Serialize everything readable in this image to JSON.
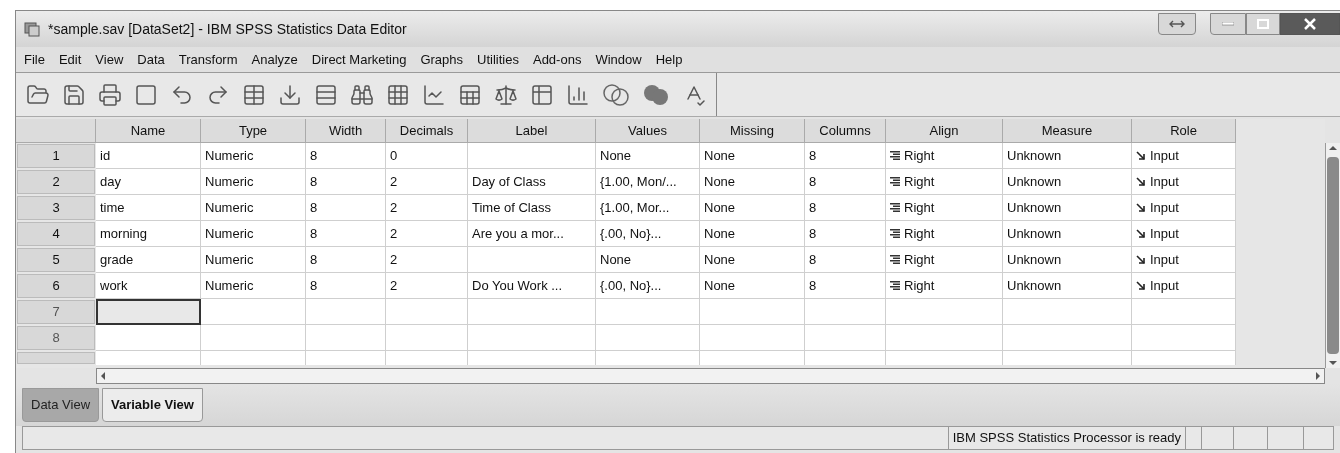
{
  "window": {
    "title": "*sample.sav [DataSet2] - IBM SPSS Statistics Data Editor"
  },
  "menu": [
    {
      "label": "File"
    },
    {
      "label": "Edit"
    },
    {
      "label": "View"
    },
    {
      "label": "Data"
    },
    {
      "label": "Transform"
    },
    {
      "label": "Analyze"
    },
    {
      "label": "Direct Marketing"
    },
    {
      "label": "Graphs"
    },
    {
      "label": "Utilities"
    },
    {
      "label": "Add-ons"
    },
    {
      "label": "Window"
    },
    {
      "label": "Help"
    }
  ],
  "columns": [
    {
      "label": "Name",
      "kind": "text"
    },
    {
      "label": "Type",
      "kind": "text"
    },
    {
      "label": "Width",
      "kind": "text"
    },
    {
      "label": "Decimals",
      "kind": "text"
    },
    {
      "label": "Label",
      "kind": "text"
    },
    {
      "label": "Values",
      "kind": "text"
    },
    {
      "label": "Missing",
      "kind": "text"
    },
    {
      "label": "Columns",
      "kind": "text"
    },
    {
      "label": "Align",
      "kind": "align"
    },
    {
      "label": "Measure",
      "kind": "text"
    },
    {
      "label": "Role",
      "kind": "role"
    }
  ],
  "rows": [
    {
      "number": "1",
      "name_cell_selected": false,
      "cells": [
        "id",
        "Numeric",
        "8",
        "0",
        null,
        "None",
        "None",
        "8",
        "Right",
        "Unknown",
        "Input"
      ]
    },
    {
      "number": "2",
      "name_cell_selected": false,
      "cells": [
        "day",
        "Numeric",
        "8",
        "2",
        "Day of Class",
        "{1.00, Mon/...",
        "None",
        "8",
        "Right",
        "Unknown",
        "Input"
      ]
    },
    {
      "number": "3",
      "name_cell_selected": false,
      "cells": [
        "time",
        "Numeric",
        "8",
        "2",
        "Time of Class",
        "{1.00, Mor...",
        "None",
        "8",
        "Right",
        "Unknown",
        "Input"
      ]
    },
    {
      "number": "4",
      "name_cell_selected": false,
      "cells": [
        "morning",
        "Numeric",
        "8",
        "2",
        "Are you a mor...",
        "{.00, No}...",
        "None",
        "8",
        "Right",
        "Unknown",
        "Input"
      ]
    },
    {
      "number": "5",
      "name_cell_selected": false,
      "cells": [
        "grade",
        "Numeric",
        "8",
        "2",
        null,
        "None",
        "None",
        "8",
        "Right",
        "Unknown",
        "Input"
      ]
    },
    {
      "number": "6",
      "name_cell_selected": false,
      "cells": [
        "work",
        "Numeric",
        "8",
        "2",
        "Do You Work ...",
        "{.00, No}...",
        "None",
        "8",
        "Right",
        "Unknown",
        "Input"
      ]
    },
    {
      "number": "7",
      "name_cell_selected": true
    },
    {
      "number": "8",
      "name_cell_selected": false
    }
  ],
  "tabs": [
    {
      "label": "Data View",
      "selected": false
    },
    {
      "label": "Variable View",
      "selected": true
    }
  ],
  "status_bar": {
    "message": "IBM SPSS Statistics Processor is ready"
  }
}
